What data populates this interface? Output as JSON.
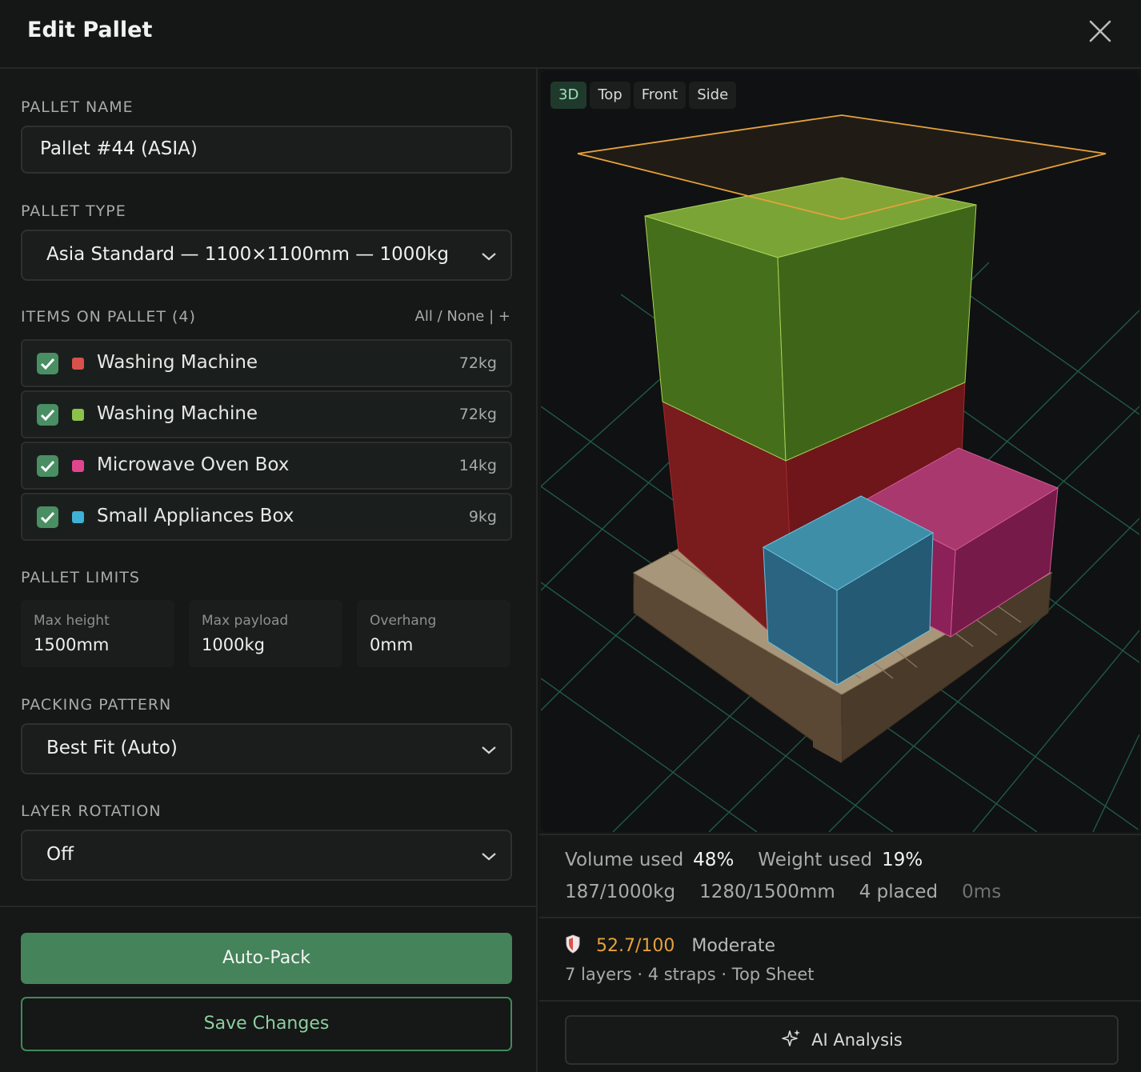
{
  "window": {
    "title": "Edit Pallet",
    "close_icon": "close-icon"
  },
  "form": {
    "pallet_name_label": "PALLET NAME",
    "pallet_name_value": "Pallet #44 (ASIA)",
    "pallet_type_label": "PALLET TYPE",
    "pallet_type_value": "Asia Standard — 1100×1100mm — 1000kg",
    "items_label": "ITEMS ON PALLET (4)",
    "items_all": "All",
    "items_slash": "/",
    "items_none": "None",
    "items_bar": "|",
    "items_add": "+",
    "items": [
      {
        "name": "Washing Machine",
        "weight": "72kg",
        "color": "#d9514b",
        "checked": true
      },
      {
        "name": "Washing Machine",
        "weight": "72kg",
        "color": "#8bc34a",
        "checked": true
      },
      {
        "name": "Microwave Oven Box",
        "weight": "14kg",
        "color": "#e0458e",
        "checked": true
      },
      {
        "name": "Small Appliances Box",
        "weight": "9kg",
        "color": "#3fb0d6",
        "checked": true
      }
    ],
    "limits_label": "PALLET LIMITS",
    "limits": [
      {
        "key": "Max height",
        "value": "1500mm"
      },
      {
        "key": "Max payload",
        "value": "1000kg"
      },
      {
        "key": "Overhang",
        "value": "0mm"
      }
    ],
    "packing_label": "PACKING PATTERN",
    "packing_value": "Best Fit (Auto)",
    "rotation_label": "LAYER ROTATION",
    "rotation_value": "Off"
  },
  "actions": {
    "auto_pack": "Auto-Pack",
    "save": "Save Changes"
  },
  "viewer": {
    "tabs": [
      "3D",
      "Top",
      "Front",
      "Side"
    ],
    "active_tab": "3D"
  },
  "stats": {
    "volume_label": "Volume used",
    "volume_value": "48%",
    "weight_label": "Weight used",
    "weight_value": "19%",
    "payload": "187/1000kg",
    "height": "1280/1500mm",
    "placed": "4 placed",
    "time": "0ms"
  },
  "stability": {
    "icon": "shield-icon",
    "score": "52.7/100",
    "level": "Moderate",
    "details": "7 layers · 4 straps · Top Sheet",
    "score_color": "#e6a23c"
  },
  "ai_button": {
    "label": "AI Analysis",
    "icon": "sparkle-icon"
  }
}
